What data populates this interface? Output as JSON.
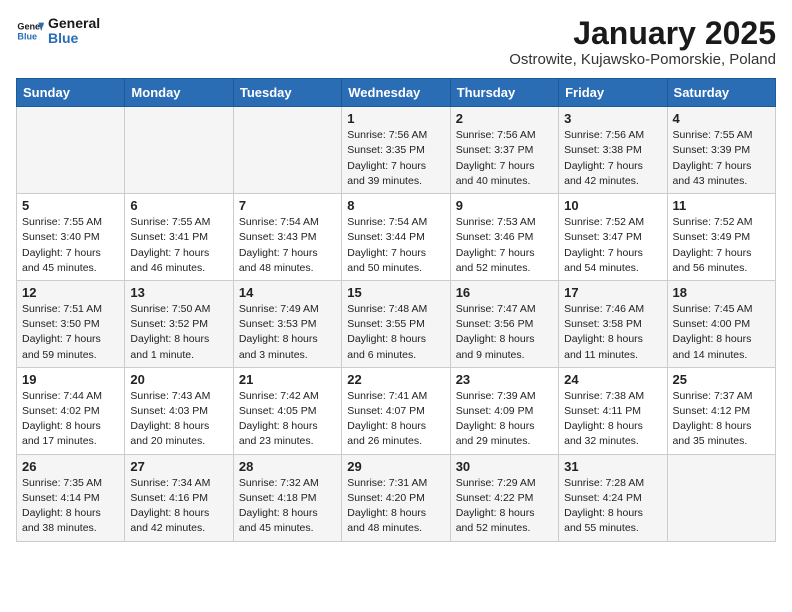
{
  "logo": {
    "line1": "General",
    "line2": "Blue"
  },
  "title": "January 2025",
  "subtitle": "Ostrowite, Kujawsko-Pomorskie, Poland",
  "days_of_week": [
    "Sunday",
    "Monday",
    "Tuesday",
    "Wednesday",
    "Thursday",
    "Friday",
    "Saturday"
  ],
  "weeks": [
    [
      {
        "day": "",
        "info": ""
      },
      {
        "day": "",
        "info": ""
      },
      {
        "day": "",
        "info": ""
      },
      {
        "day": "1",
        "info": "Sunrise: 7:56 AM\nSunset: 3:35 PM\nDaylight: 7 hours\nand 39 minutes."
      },
      {
        "day": "2",
        "info": "Sunrise: 7:56 AM\nSunset: 3:37 PM\nDaylight: 7 hours\nand 40 minutes."
      },
      {
        "day": "3",
        "info": "Sunrise: 7:56 AM\nSunset: 3:38 PM\nDaylight: 7 hours\nand 42 minutes."
      },
      {
        "day": "4",
        "info": "Sunrise: 7:55 AM\nSunset: 3:39 PM\nDaylight: 7 hours\nand 43 minutes."
      }
    ],
    [
      {
        "day": "5",
        "info": "Sunrise: 7:55 AM\nSunset: 3:40 PM\nDaylight: 7 hours\nand 45 minutes."
      },
      {
        "day": "6",
        "info": "Sunrise: 7:55 AM\nSunset: 3:41 PM\nDaylight: 7 hours\nand 46 minutes."
      },
      {
        "day": "7",
        "info": "Sunrise: 7:54 AM\nSunset: 3:43 PM\nDaylight: 7 hours\nand 48 minutes."
      },
      {
        "day": "8",
        "info": "Sunrise: 7:54 AM\nSunset: 3:44 PM\nDaylight: 7 hours\nand 50 minutes."
      },
      {
        "day": "9",
        "info": "Sunrise: 7:53 AM\nSunset: 3:46 PM\nDaylight: 7 hours\nand 52 minutes."
      },
      {
        "day": "10",
        "info": "Sunrise: 7:52 AM\nSunset: 3:47 PM\nDaylight: 7 hours\nand 54 minutes."
      },
      {
        "day": "11",
        "info": "Sunrise: 7:52 AM\nSunset: 3:49 PM\nDaylight: 7 hours\nand 56 minutes."
      }
    ],
    [
      {
        "day": "12",
        "info": "Sunrise: 7:51 AM\nSunset: 3:50 PM\nDaylight: 7 hours\nand 59 minutes."
      },
      {
        "day": "13",
        "info": "Sunrise: 7:50 AM\nSunset: 3:52 PM\nDaylight: 8 hours\nand 1 minute."
      },
      {
        "day": "14",
        "info": "Sunrise: 7:49 AM\nSunset: 3:53 PM\nDaylight: 8 hours\nand 3 minutes."
      },
      {
        "day": "15",
        "info": "Sunrise: 7:48 AM\nSunset: 3:55 PM\nDaylight: 8 hours\nand 6 minutes."
      },
      {
        "day": "16",
        "info": "Sunrise: 7:47 AM\nSunset: 3:56 PM\nDaylight: 8 hours\nand 9 minutes."
      },
      {
        "day": "17",
        "info": "Sunrise: 7:46 AM\nSunset: 3:58 PM\nDaylight: 8 hours\nand 11 minutes."
      },
      {
        "day": "18",
        "info": "Sunrise: 7:45 AM\nSunset: 4:00 PM\nDaylight: 8 hours\nand 14 minutes."
      }
    ],
    [
      {
        "day": "19",
        "info": "Sunrise: 7:44 AM\nSunset: 4:02 PM\nDaylight: 8 hours\nand 17 minutes."
      },
      {
        "day": "20",
        "info": "Sunrise: 7:43 AM\nSunset: 4:03 PM\nDaylight: 8 hours\nand 20 minutes."
      },
      {
        "day": "21",
        "info": "Sunrise: 7:42 AM\nSunset: 4:05 PM\nDaylight: 8 hours\nand 23 minutes."
      },
      {
        "day": "22",
        "info": "Sunrise: 7:41 AM\nSunset: 4:07 PM\nDaylight: 8 hours\nand 26 minutes."
      },
      {
        "day": "23",
        "info": "Sunrise: 7:39 AM\nSunset: 4:09 PM\nDaylight: 8 hours\nand 29 minutes."
      },
      {
        "day": "24",
        "info": "Sunrise: 7:38 AM\nSunset: 4:11 PM\nDaylight: 8 hours\nand 32 minutes."
      },
      {
        "day": "25",
        "info": "Sunrise: 7:37 AM\nSunset: 4:12 PM\nDaylight: 8 hours\nand 35 minutes."
      }
    ],
    [
      {
        "day": "26",
        "info": "Sunrise: 7:35 AM\nSunset: 4:14 PM\nDaylight: 8 hours\nand 38 minutes."
      },
      {
        "day": "27",
        "info": "Sunrise: 7:34 AM\nSunset: 4:16 PM\nDaylight: 8 hours\nand 42 minutes."
      },
      {
        "day": "28",
        "info": "Sunrise: 7:32 AM\nSunset: 4:18 PM\nDaylight: 8 hours\nand 45 minutes."
      },
      {
        "day": "29",
        "info": "Sunrise: 7:31 AM\nSunset: 4:20 PM\nDaylight: 8 hours\nand 48 minutes."
      },
      {
        "day": "30",
        "info": "Sunrise: 7:29 AM\nSunset: 4:22 PM\nDaylight: 8 hours\nand 52 minutes."
      },
      {
        "day": "31",
        "info": "Sunrise: 7:28 AM\nSunset: 4:24 PM\nDaylight: 8 hours\nand 55 minutes."
      },
      {
        "day": "",
        "info": ""
      }
    ]
  ]
}
